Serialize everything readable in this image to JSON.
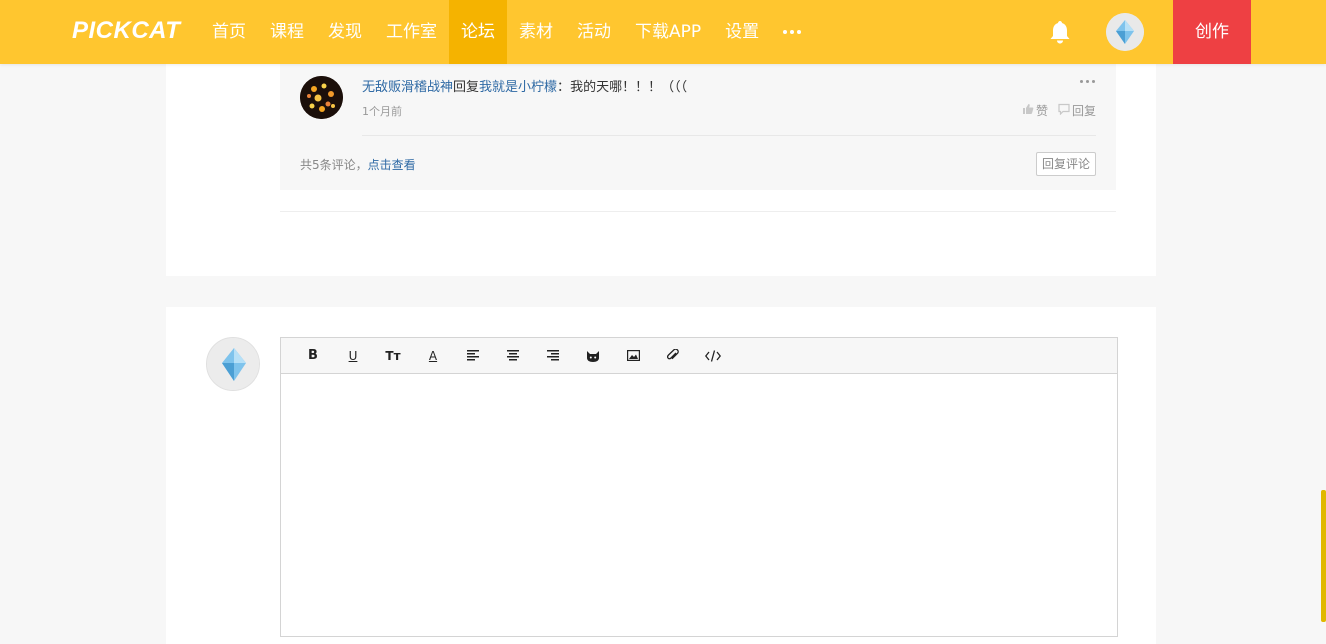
{
  "brand": {
    "logo": "PICKCAT"
  },
  "nav": {
    "items": [
      {
        "label": "首页"
      },
      {
        "label": "课程"
      },
      {
        "label": "发现"
      },
      {
        "label": "工作室"
      },
      {
        "label": "论坛",
        "active": true
      },
      {
        "label": "素材"
      },
      {
        "label": "活动"
      },
      {
        "label": "下载APP"
      },
      {
        "label": "设置"
      }
    ],
    "create_label": "创作"
  },
  "reply": {
    "author": "无敌贩滑稽战神",
    "verb": "回复",
    "target": "我就是小柠檬",
    "colon": "：",
    "text": "我的天哪！！！（（（",
    "time": "1个月前",
    "like_label": "赞",
    "reply_label": "回复",
    "count_text": "共5条评论，",
    "view_link": "点击查看",
    "comment_button": "回复评论"
  },
  "editor": {
    "tools": [
      "bold-icon",
      "underline-icon",
      "text-size-icon",
      "font-color-icon",
      "align-left-icon",
      "align-center-icon",
      "align-right-icon",
      "cat-emoji-icon",
      "image-icon",
      "attachment-icon",
      "code-icon"
    ],
    "tool_glyphs": {
      "bold": "B",
      "underline": "U",
      "text_size": "Tт",
      "font_color": "A"
    },
    "content": ""
  },
  "colors": {
    "header": "#ffc62f",
    "header_active": "#f5b300",
    "create": "#ee4043",
    "link": "#2f6aa5"
  }
}
